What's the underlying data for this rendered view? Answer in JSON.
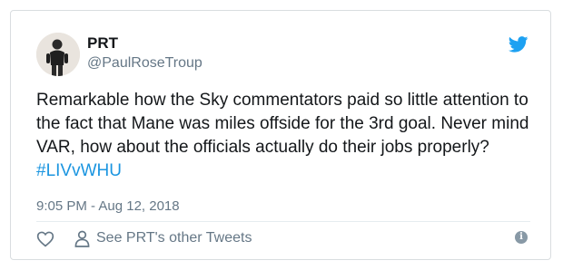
{
  "tweet": {
    "author_name": "PRT",
    "author_handle": "@PaulRoseTroup",
    "text_before": "Remarkable how the Sky commentators paid so little attention to the fact that Mane was miles offside for the 3rd goal. Never mind VAR, how about the officials actually do their jobs properly? ",
    "hashtag": "#LIVvWHU",
    "timestamp": "9:05 PM - Aug 12, 2018",
    "other_tweets_label": "See PRT's other Tweets",
    "info_glyph": "i"
  },
  "icons": {
    "brand": "twitter-bird-icon",
    "like": "heart-icon",
    "profile": "person-icon",
    "info": "info-icon"
  },
  "colors": {
    "brand_blue": "#1da1f2",
    "link_blue": "#1b95e0",
    "muted_gray": "#657786",
    "text_dark": "#14171a"
  }
}
